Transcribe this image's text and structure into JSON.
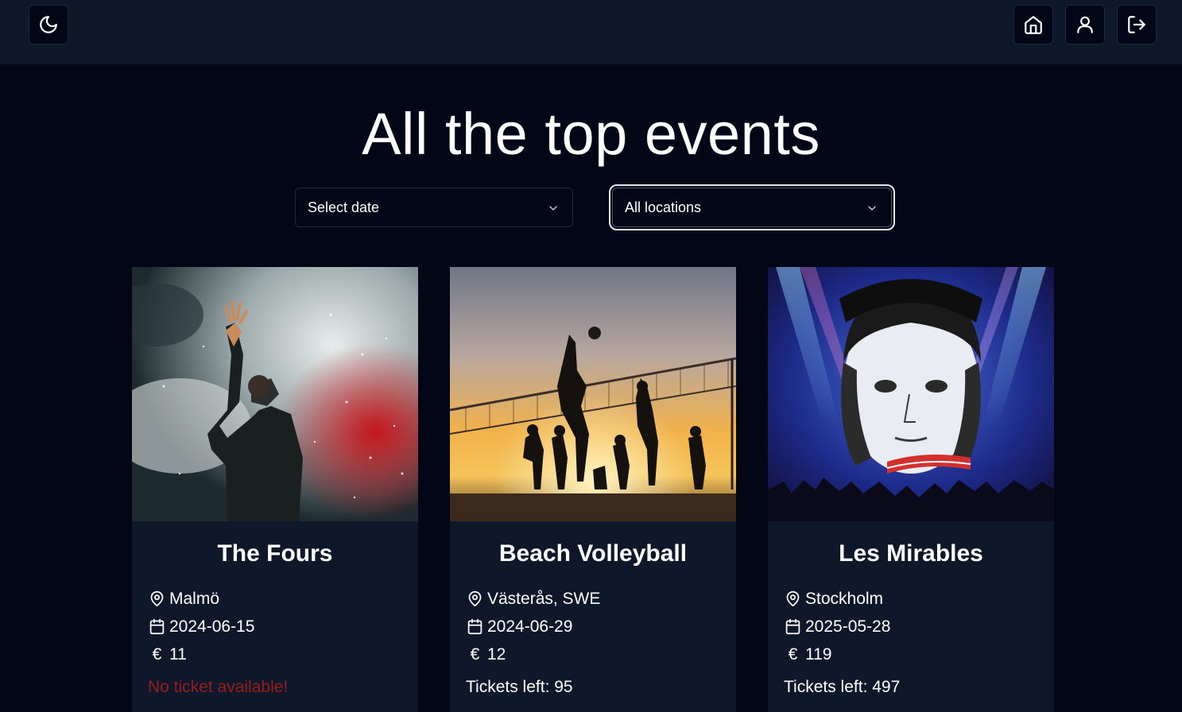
{
  "header": {
    "theme_toggle_icon": "moon-icon",
    "home_icon": "home-icon",
    "profile_icon": "user-icon",
    "logout_icon": "log-out-icon"
  },
  "page": {
    "title": "All the top events"
  },
  "filters": {
    "date": {
      "value": "Select date"
    },
    "location": {
      "value": "All locations"
    }
  },
  "events": [
    {
      "title": "The Fours",
      "location": "Malmö",
      "date": "2024-06-15",
      "currency_symbol": "€",
      "price": "11",
      "status": "No ticket available!",
      "status_color": "#991b1b"
    },
    {
      "title": "Beach Volleyball",
      "location": "Västerås, SWE",
      "date": "2024-06-29",
      "currency_symbol": "€",
      "price": "12",
      "status": "Tickets left: 95",
      "status_color": "#ffffff"
    },
    {
      "title": "Les Mirables",
      "location": "Stockholm",
      "date": "2025-05-28",
      "currency_symbol": "€",
      "price": "119",
      "status": "Tickets left: 497",
      "status_color": "#ffffff"
    }
  ],
  "colors": {
    "background": "#020617",
    "header": "#0f172a",
    "card": "#0f172a",
    "error": "#991b1b"
  }
}
